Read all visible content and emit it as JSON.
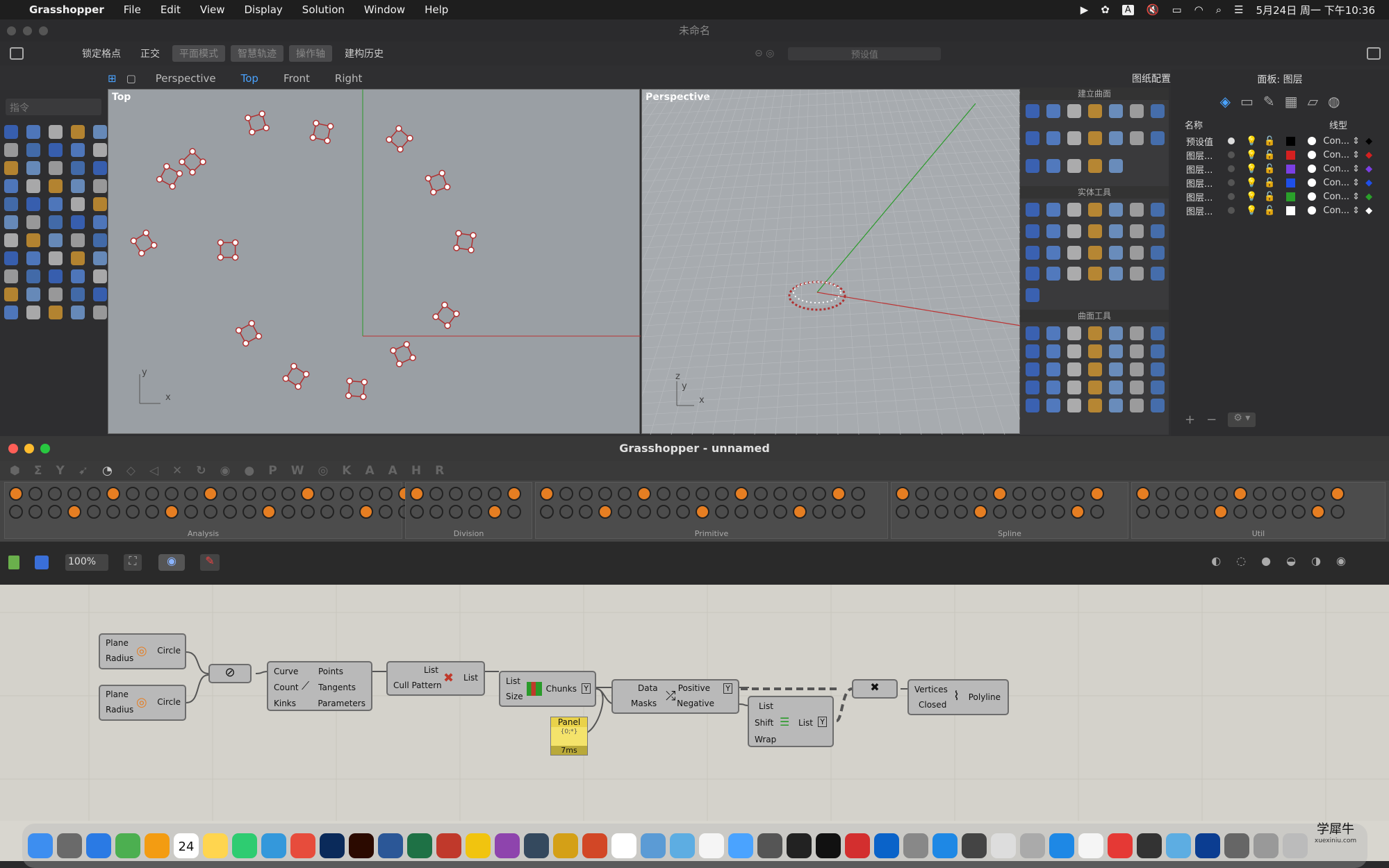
{
  "menubar": {
    "app": "Grasshopper",
    "items": [
      "File",
      "Edit",
      "View",
      "Display",
      "Solution",
      "Window",
      "Help"
    ],
    "status_letter": "A",
    "datetime": "5月24日 周一 下午10:36"
  },
  "rhino": {
    "title": "未命名",
    "toolbar": [
      "锁定格点",
      "正交",
      "平面模式",
      "智慧轨迹",
      "操作轴",
      "建构历史"
    ],
    "preset_placeholder": "预设值",
    "viewport_tabs": [
      "Perspective",
      "Top",
      "Front",
      "Right"
    ],
    "active_tab": "Top",
    "viewport_config": "图纸配置",
    "command_placeholder": "指令",
    "top_view_label": "Top",
    "persp_view_label": "Perspective",
    "axis_y": "y",
    "axis_x": "x",
    "axis_z": "z",
    "panel_titles": [
      "建立曲面",
      "实体工具",
      "曲面工具"
    ],
    "layers": {
      "title": "面板: 图层",
      "col_name": "名称",
      "col_linetype": "线型",
      "rows": [
        {
          "name": "预设值",
          "color": "#000000",
          "line": "Con..."
        },
        {
          "name": "图层...",
          "color": "#d42020",
          "line": "Con..."
        },
        {
          "name": "图层...",
          "color": "#7b3fe4",
          "line": "Con..."
        },
        {
          "name": "图层...",
          "color": "#1f4fe8",
          "line": "Con..."
        },
        {
          "name": "图层...",
          "color": "#2aa02a",
          "line": "Con..."
        },
        {
          "name": "图层...",
          "color": "#ffffff",
          "line": "Con..."
        }
      ]
    }
  },
  "grasshopper": {
    "title": "Grasshopper - unnamed",
    "tab_letters": [
      "P",
      "W",
      "K",
      "A",
      "A",
      "H",
      "R"
    ],
    "ribbon_groups": [
      "Analysis",
      "Division",
      "Primitive",
      "Spline",
      "Util"
    ],
    "zoom": "100%",
    "components": {
      "circle1": {
        "in": [
          "Plane",
          "Radius"
        ],
        "name": "Circle"
      },
      "circle2": {
        "in": [
          "Plane",
          "Radius"
        ],
        "name": "Circle"
      },
      "divide": {
        "in": [
          "Curve",
          "Count",
          "Kinks"
        ],
        "out": [
          "Points",
          "Tangents",
          "Parameters"
        ]
      },
      "cull": {
        "in": [
          "List",
          "Cull Pattern"
        ],
        "out": "List"
      },
      "chunks": {
        "in": [
          "List",
          "Size"
        ],
        "out": "Chunks",
        "flag": "Y"
      },
      "panel": {
        "title": "Panel",
        "content": "{0;*}",
        "time": "7ms"
      },
      "dispatch": {
        "in": [
          "Data",
          "Masks"
        ],
        "out": [
          "Positive",
          "Negative"
        ],
        "flag": "Y"
      },
      "shift": {
        "in": [
          "List",
          "Shift",
          "Wrap"
        ],
        "out": "List",
        "flag": "Y"
      },
      "polyline": {
        "in": [
          "Vertices",
          "Closed"
        ],
        "name": "Polyline"
      }
    }
  },
  "dock": {
    "calendar_day": "24",
    "watermark": "学犀牛",
    "watermark_url": "xuexiniu.com"
  },
  "colors": {
    "accent": "#4aa3ff",
    "point_red": "#c0392b",
    "panel_yellow": "#f4e36b"
  }
}
